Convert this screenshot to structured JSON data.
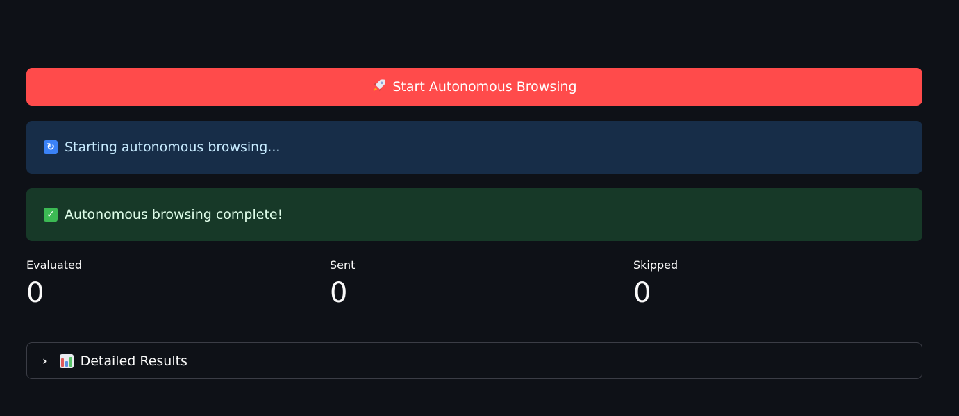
{
  "colors": {
    "background": "#0e1117",
    "primary_button": "#ff4b4b",
    "info_bg": "#172d48",
    "info_text": "#c7ebff",
    "success_bg": "#173928",
    "success_text": "#dffde9",
    "info_icon": "#3b82f6",
    "success_icon": "#3cba54"
  },
  "actions": {
    "start_button": {
      "icon": "rocket-icon",
      "label": "Start Autonomous Browsing"
    }
  },
  "alerts": {
    "info": {
      "icon": "refresh-icon",
      "text": "Starting autonomous browsing..."
    },
    "success": {
      "icon": "check-icon",
      "text": "Autonomous browsing complete!"
    }
  },
  "metrics": [
    {
      "label": "Evaluated",
      "value": "0"
    },
    {
      "label": "Sent",
      "value": "0"
    },
    {
      "label": "Skipped",
      "value": "0"
    }
  ],
  "expander": {
    "icon": "bar-chart-icon",
    "label": "Detailed Results"
  }
}
